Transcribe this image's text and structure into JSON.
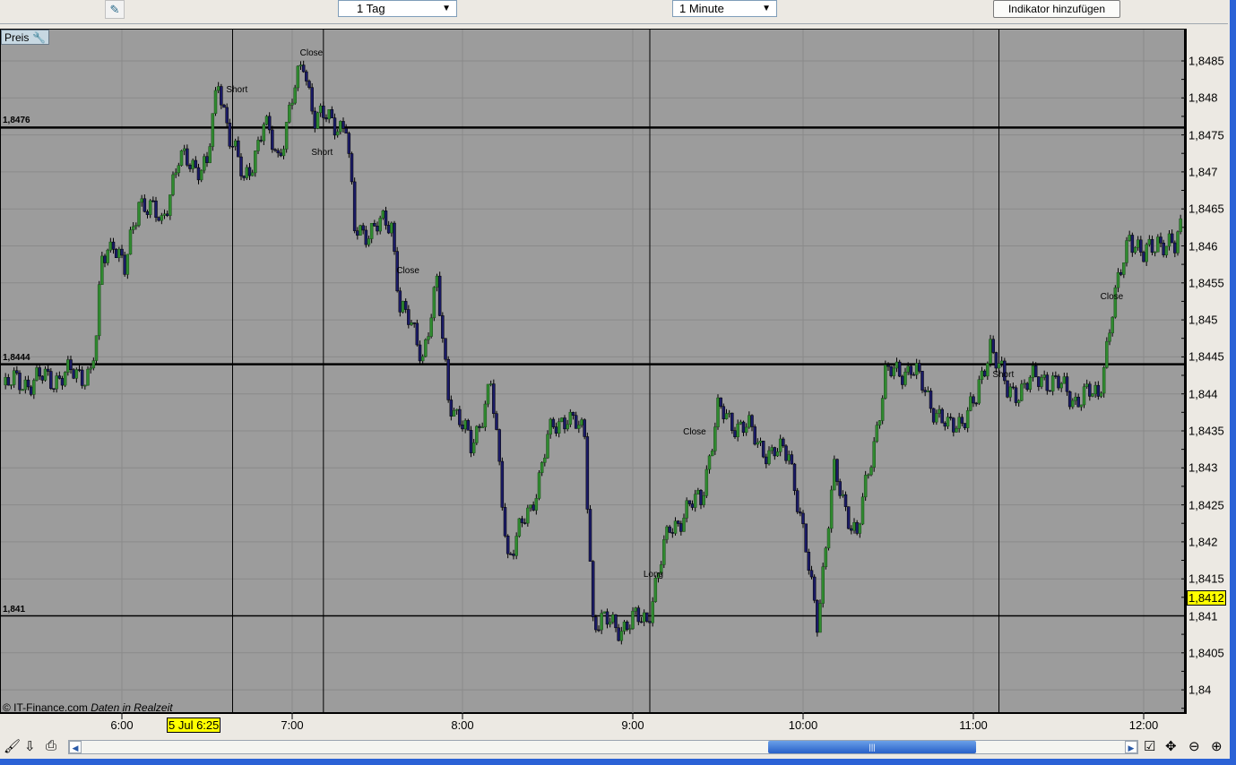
{
  "toolbar": {
    "period_select": "1 Tag",
    "interval_select": "1 Minute",
    "add_indicator_button": "Indikator hinzufügen",
    "draw_tool_icon": "ruler-pen-icon"
  },
  "panel": {
    "label": "Preis",
    "settings_icon": "wrench-icon",
    "copyright": "© IT-Finance.com",
    "realtime": "Daten in Realzeit"
  },
  "cursor": {
    "time": "5 Jul 6:25",
    "price": "1,8412"
  },
  "bottom_icons": [
    "brush-icon",
    "export-icon",
    "print-icon",
    "settings-check-icon",
    "move-icon",
    "zoom-out-icon",
    "zoom-in-icon"
  ],
  "colors": {
    "up": "#2f8a2f",
    "down": "#1a1a66",
    "background": "#9c9c9c",
    "cursor": "#ffff00"
  },
  "chart_data": {
    "type": "candlestick",
    "interval": "1 minute",
    "ylim": [
      1.8397,
      1.8494
    ],
    "xlim": [
      "5:17",
      "12:17"
    ],
    "y_ticks": [
      "1,84",
      "1,8405",
      "1,841",
      "1,8415",
      "1,842",
      "1,8425",
      "1,843",
      "1,8435",
      "1,844",
      "1,8445",
      "1,845",
      "1,8455",
      "1,846",
      "1,8465",
      "1,847",
      "1,8475",
      "1,848",
      "1,8485"
    ],
    "y_tick_values": [
      1.84,
      1.8405,
      1.841,
      1.8415,
      1.842,
      1.8425,
      1.843,
      1.8435,
      1.844,
      1.8445,
      1.845,
      1.8455,
      1.846,
      1.8465,
      1.847,
      1.8475,
      1.848,
      1.8485
    ],
    "x_ticks": [
      "6:00",
      "7:00",
      "8:00",
      "9:00",
      "10:00",
      "11:00",
      "12:00"
    ],
    "session_lines": [
      "6:39",
      "7:11",
      "9:06",
      "11:09"
    ],
    "horizontal_lines": [
      {
        "label": "1,8476",
        "value": 1.8476,
        "weight": "thick"
      },
      {
        "label": "1,8444",
        "value": 1.8444,
        "weight": "thick"
      },
      {
        "label": "1,841",
        "value": 1.841,
        "weight": "normal"
      }
    ],
    "annotations": [
      {
        "text": "Short",
        "time": "6:38",
        "price": 1.8481
      },
      {
        "text": "Close",
        "time": "7:04",
        "price": 1.8486
      },
      {
        "text": "Short",
        "time": "7:08",
        "price": 1.84725
      },
      {
        "text": "Close",
        "time": "7:38",
        "price": 1.84565
      },
      {
        "text": "Close",
        "time": "9:19",
        "price": 1.84348
      },
      {
        "text": "Long",
        "time": "9:05",
        "price": 1.84155
      },
      {
        "text": "Short",
        "time": "11:08",
        "price": 1.84425
      },
      {
        "text": "Close",
        "time": "11:46",
        "price": 1.8453
      }
    ],
    "close_path": [
      [
        "5:19",
        1.84412
      ],
      [
        "5:49",
        1.8443
      ],
      [
        "5:51",
        1.84472
      ],
      [
        "5:53",
        1.84581
      ],
      [
        "5:57",
        1.84611
      ],
      [
        "6:01",
        1.84563
      ],
      [
        "6:06",
        1.84666
      ],
      [
        "6:14",
        1.8463
      ],
      [
        "6:17",
        1.84678
      ],
      [
        "6:20",
        1.84714
      ],
      [
        "6:30",
        1.84708
      ],
      [
        "6:34",
        1.84823
      ],
      [
        "6:38",
        1.84751
      ],
      [
        "6:43",
        1.84684
      ],
      [
        "6:50",
        1.84763
      ],
      [
        "6:55",
        1.8472
      ],
      [
        "7:01",
        1.84811
      ],
      [
        "7:04",
        1.84848
      ],
      [
        "7:08",
        1.84775
      ],
      [
        "7:19",
        1.84763
      ],
      [
        "7:22",
        1.84618
      ],
      [
        "7:35",
        1.8463
      ],
      [
        "7:38",
        1.84521
      ],
      [
        "7:46",
        1.84454
      ],
      [
        "7:51",
        1.84545
      ],
      [
        "7:55",
        1.844
      ],
      [
        "8:03",
        1.84327
      ],
      [
        "8:10",
        1.84412
      ],
      [
        "8:16",
        1.84182
      ],
      [
        "8:24",
        1.84243
      ],
      [
        "8:30",
        1.84339
      ],
      [
        "8:37",
        1.84375
      ],
      [
        "8:43",
        1.84339
      ],
      [
        "8:46",
        1.84097
      ],
      [
        "8:54",
        1.84085
      ],
      [
        "9:05",
        1.84097
      ],
      [
        "9:13",
        1.84218
      ],
      [
        "9:24",
        1.8426
      ],
      [
        "9:30",
        1.84375
      ],
      [
        "9:41",
        1.8435
      ],
      [
        "9:49",
        1.84315
      ],
      [
        "9:55",
        1.84327
      ],
      [
        "10:00",
        1.84206
      ],
      [
        "10:05",
        1.84097
      ],
      [
        "10:11",
        1.84291
      ],
      [
        "10:19",
        1.84206
      ],
      [
        "10:29",
        1.84424
      ],
      [
        "10:38",
        1.84436
      ],
      [
        "10:51",
        1.8435
      ],
      [
        "11:01",
        1.84388
      ],
      [
        "11:06",
        1.84472
      ],
      [
        "11:12",
        1.844
      ],
      [
        "11:25",
        1.84424
      ],
      [
        "11:36",
        1.84394
      ],
      [
        "11:44",
        1.844
      ],
      [
        "11:49",
        1.84509
      ],
      [
        "11:55",
        1.8462
      ],
      [
        "12:00",
        1.84581
      ],
      [
        "12:05",
        1.84611
      ],
      [
        "12:11",
        1.84593
      ],
      [
        "12:14",
        1.84642
      ]
    ]
  }
}
